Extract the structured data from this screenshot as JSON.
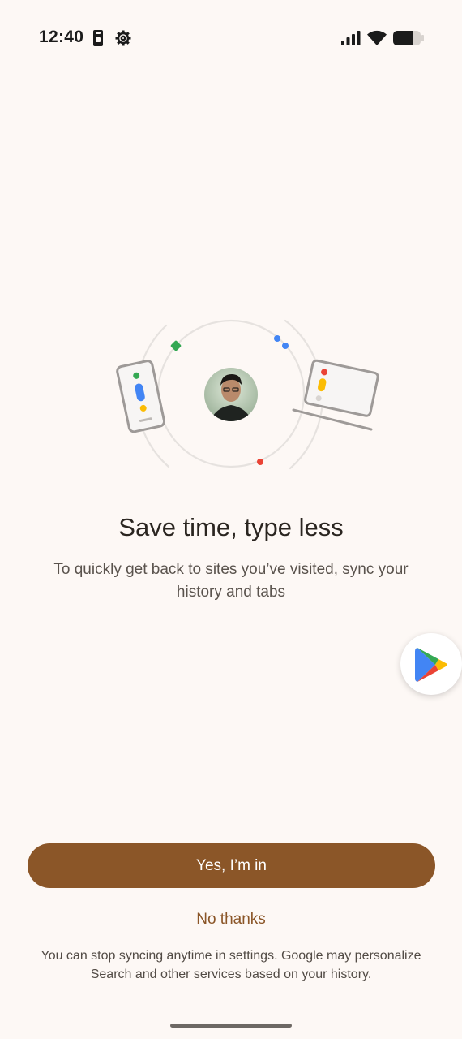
{
  "status_bar": {
    "time": "12:40",
    "left_icons": [
      "screen-record-icon",
      "gear-icon"
    ],
    "right_icons": [
      "signal-icon",
      "wifi-icon",
      "battery-icon"
    ]
  },
  "illustration": {
    "elements": [
      "phone-icon",
      "avatar",
      "laptop-icon",
      "orbit-ring"
    ]
  },
  "main": {
    "title": "Save time, type less",
    "subtitle": "To quickly get back to sites you’ve visited, sync your history and tabs"
  },
  "floating": {
    "icon": "play-store-icon"
  },
  "actions": {
    "primary_label": "Yes, I’m in",
    "secondary_label": "No thanks"
  },
  "footer": {
    "note": "You can stop syncing anytime in settings. Google may personalize Search and other services based on your history."
  },
  "colors": {
    "background": "#fdf8f5",
    "accent": "#8b5628",
    "google_blue": "#4285f4",
    "google_red": "#ea4335",
    "google_yellow": "#fbbc04",
    "google_green": "#34a853"
  }
}
